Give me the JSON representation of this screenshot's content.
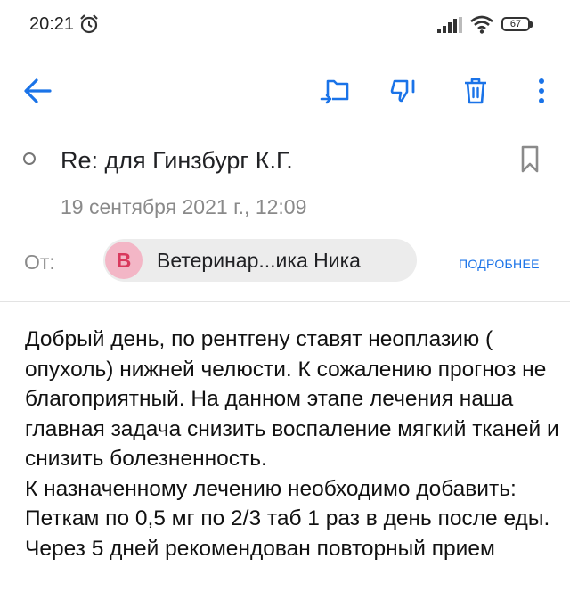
{
  "status_bar": {
    "time": "20:21",
    "battery": "67",
    "icons": [
      "alarm-icon",
      "signal-icon",
      "wifi-icon",
      "battery-icon"
    ]
  },
  "toolbar": {
    "icons": [
      "back-arrow-icon",
      "move-to-folder-icon",
      "spam-icon",
      "trash-icon",
      "more-vert-icon"
    ],
    "accent_color": "#1a73e8"
  },
  "message": {
    "subject": "Re: для Гинзбург К.Г.",
    "date": "19 сентября 2021 г., 12:09",
    "from_label": "От:",
    "sender": {
      "initial": "В",
      "name": "Ветеринар...ика Ника",
      "avatar_bg": "#f3b6c6",
      "avatar_fg": "#d9395d"
    },
    "details_link": "ПОДРОБНЕЕ",
    "body": [
      "Добрый день, по рентгену ставят неоплазию ( опухоль) нижней челюсти. К сожалению прогноз не благоприятный. На данном этапе лечения наша главная задача снизить воспаление мягкий тканей и снизить болезненность.",
      "К назначенному лечению необходимо добавить: Петкам по 0,5 мг по 2/3 таб 1 раз в день после еды. Через 5 дней рекомендован повторный прием"
    ]
  }
}
